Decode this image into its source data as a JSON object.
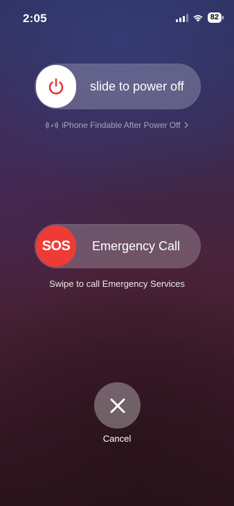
{
  "status_bar": {
    "time": "2:05",
    "battery": "82",
    "icons": [
      "signal-icon",
      "wifi-icon",
      "battery-icon"
    ]
  },
  "power_slider": {
    "label": "slide to power off",
    "icon": "power-icon",
    "icon_color": "#e53935"
  },
  "findable": {
    "text": "iPhone Findable After Power Off",
    "icon": "find-my-icon",
    "chevron": "chevron-right-icon"
  },
  "sos_slider": {
    "knob_text": "SOS",
    "label": "Emergency Call",
    "knob_color": "#ee3b35"
  },
  "sos_hint": "Swipe to call Emergency Services",
  "cancel": {
    "label": "Cancel",
    "icon": "close-icon"
  }
}
